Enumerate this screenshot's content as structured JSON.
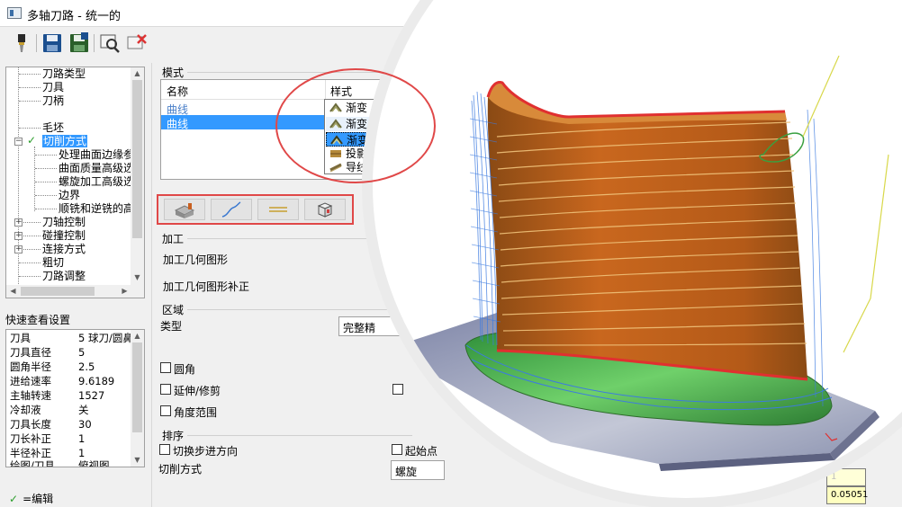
{
  "window": {
    "title": "多轴刀路 - 统一的"
  },
  "toolbar": {
    "buttons": [
      {
        "name": "tool-select-icon"
      },
      {
        "name": "save-icon"
      },
      {
        "name": "save-as-icon"
      },
      {
        "name": "preview-icon"
      },
      {
        "name": "delete-icon"
      }
    ]
  },
  "tree": {
    "items": [
      {
        "label": "刀路类型"
      },
      {
        "label": "刀具"
      },
      {
        "label": "刀柄"
      },
      {
        "label": "毛坯"
      },
      {
        "label": "切削方式"
      },
      {
        "label": "处理曲面边缘参"
      },
      {
        "label": "曲面质量高级选"
      },
      {
        "label": "螺旋加工高级选"
      },
      {
        "label": "边界"
      },
      {
        "label": "顺铣和逆铣的高"
      },
      {
        "label": "刀轴控制"
      },
      {
        "label": "碰撞控制"
      },
      {
        "label": "连接方式"
      },
      {
        "label": "粗切"
      },
      {
        "label": "刀路调整"
      }
    ]
  },
  "quickview": {
    "title": "快速查看设置",
    "rows": [
      {
        "k": "刀具",
        "v": "5 球刀/圆鼻"
      },
      {
        "k": "刀具直径",
        "v": "5"
      },
      {
        "k": "圆角半径",
        "v": "2.5"
      },
      {
        "k": "进给速率",
        "v": "9.6189"
      },
      {
        "k": "主轴转速",
        "v": "1527"
      },
      {
        "k": "冷却液",
        "v": "关"
      },
      {
        "k": "刀具长度",
        "v": "30"
      },
      {
        "k": "刀长补正",
        "v": "1"
      },
      {
        "k": "半径补正",
        "v": "1"
      },
      {
        "k": "绘图/刀具",
        "v": "俯视图"
      }
    ]
  },
  "status": {
    "edit_label": "=编辑"
  },
  "form": {
    "mode_group": "模式",
    "mode_headers": {
      "name": "名称",
      "style": "样式"
    },
    "mode_rows": [
      {
        "name": "曲线",
        "style": "渐变"
      },
      {
        "name": "曲线",
        "style": ""
      }
    ],
    "style_options": [
      "渐变",
      "渐变",
      "投影",
      "导线"
    ],
    "machining_group": "加工",
    "machining_geometry": "加工几何图形",
    "machining_geometry_offset": "加工几何图形补正",
    "region_group": "区域",
    "type_label": "类型",
    "type_value": "完整精",
    "corner": "圆角",
    "extend_trim": "延伸/修剪",
    "angle_range": "角度范围",
    "sort_group": "排序",
    "step_direction": "切换步进方向",
    "start_point": "起始点",
    "cut_method_label": "切削方式",
    "cut_method_value": "螺旋",
    "field1": "1",
    "field2": "0.05051"
  },
  "colors": {
    "selection": "#3399ff",
    "annotation_red": "#e04848",
    "blade_orange": "#c9671e",
    "hub_green": "#4fb84f",
    "toolpath_blue": "#3d7be0"
  }
}
